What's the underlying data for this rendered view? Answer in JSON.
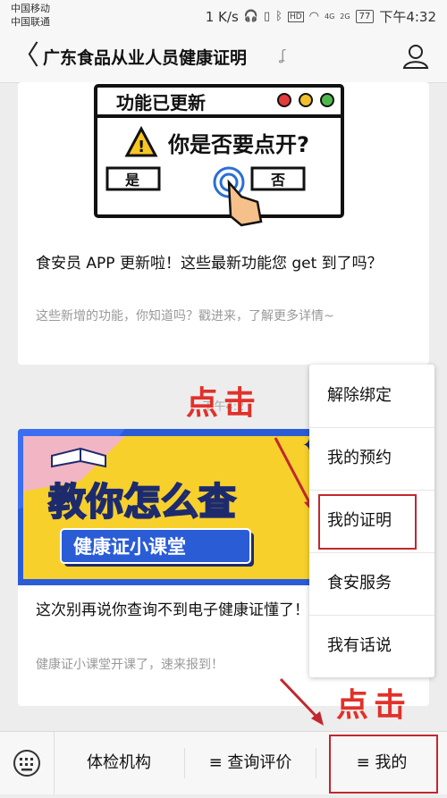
{
  "status": {
    "carrier_1": "中国移动",
    "carrier_2": "中国联通",
    "speed": "1 K/s",
    "hd": "HD",
    "signal_4g": "4G",
    "signal_2g": "2G",
    "battery": "77",
    "time": "下午4:32"
  },
  "navbar": {
    "back_glyph": "〈",
    "title": "广东食品从业人员健康证明"
  },
  "articles": [
    {
      "image": {
        "window_title": "功能已更新",
        "question": "你是否要点开?",
        "yes": "是",
        "no": "否"
      },
      "title": "食安员 APP 更新啦！这些最新功能您 get 到了吗？",
      "subtitle": "这些新增的功能，你知道吗？戳进来，了解更多详情~"
    },
    {
      "image": {
        "headline": "教你怎么查",
        "banner": "健康证小课堂"
      },
      "title": "这次别再说你查询不到电子健康证懂了！",
      "subtitle": "健康证小课堂开课了，速来报到！"
    }
  ],
  "timestamp": "下午4:2",
  "annotations": {
    "click_1": "点击",
    "click_2": "点击"
  },
  "menu": {
    "items": [
      {
        "label": "解除绑定"
      },
      {
        "label": "我的预约"
      },
      {
        "label": "我的证明"
      },
      {
        "label": "食安服务"
      },
      {
        "label": "我有话说"
      }
    ]
  },
  "tabbar": {
    "tab_1": "体检机构",
    "tab_2": "≡ 查询评价",
    "tab_3": "≡ 我的"
  },
  "colors": {
    "annotation_red": "#e1312a",
    "highlight_box": "#c0282e",
    "banner_yellow": "#f7d02c",
    "banner_blue": "#2a5cd6"
  }
}
